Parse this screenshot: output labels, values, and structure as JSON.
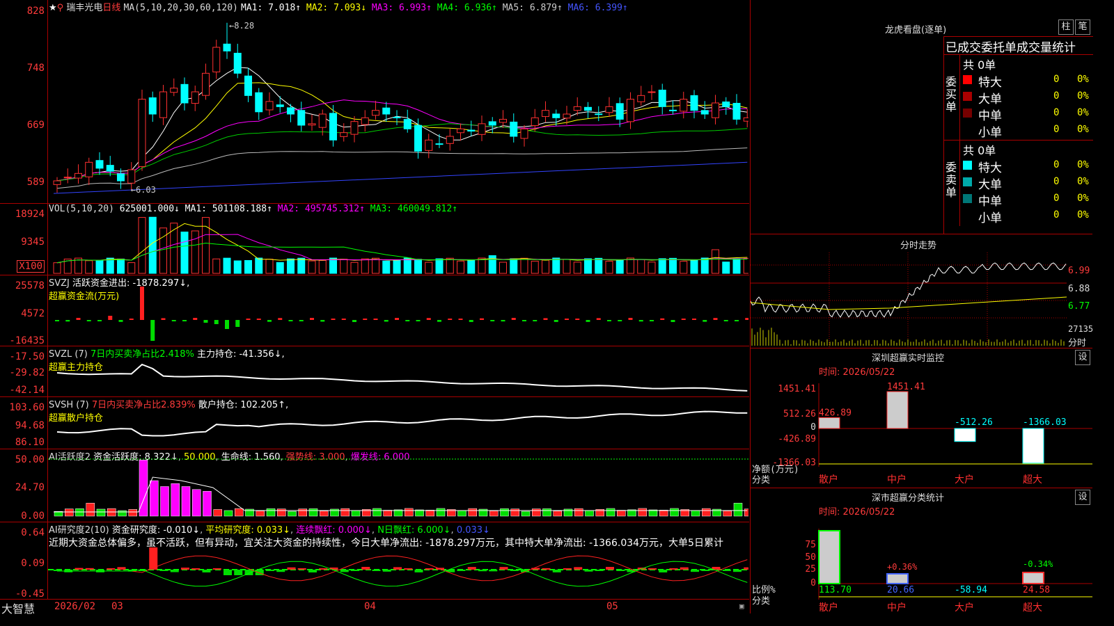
{
  "stock": {
    "name": "瑞丰光电",
    "period": "日线",
    "ma_label": "MA(5,10,20,30,60,120)",
    "ma": [
      {
        "t": "MA1: 7.018↑",
        "c": "#ffffff"
      },
      {
        "t": "MA2: 7.093↓",
        "c": "#ffff00"
      },
      {
        "t": "MA3: 6.993↑",
        "c": "#ff00ff"
      },
      {
        "t": "MA4: 6.936↑",
        "c": "#00ff00"
      },
      {
        "t": "MA5: 6.879↑",
        "c": "#cccccc"
      },
      {
        "t": "MA6: 6.399↑",
        "c": "#4455ff"
      }
    ],
    "hi_note": "8.28",
    "lo_note": "6.03",
    "y_ticks": [
      "828",
      "748",
      "669",
      "589"
    ]
  },
  "vol": {
    "label": "VOL(5,10,20)",
    "val": "625001.000↓",
    "ma1": "MA1: 501108.188↑",
    "ma2": "MA2: 495745.312↑",
    "ma3": "MA3: 460049.812↑",
    "y_ticks": [
      "18924",
      "9345"
    ],
    "unit": "X100"
  },
  "svzj": {
    "label": "SVZJ",
    "text": "活跃资金进出: -1878.297↓,",
    "sub": "超赢资金流(万元)",
    "y_ticks": [
      "25578",
      "4572",
      "-16435"
    ]
  },
  "svzl": {
    "label": "SVZL (7)",
    "text1": "7日内买卖净占比2.418%",
    "text2": "主力持仓: -41.356↓,",
    "sub": "超赢主力持仓",
    "y_ticks": [
      "-17.50",
      "-29.82",
      "-42.14"
    ]
  },
  "svsh": {
    "label": "SVSH (7)",
    "text1": "7日内买卖净占比2.839%",
    "text2": "散户持仓: 102.205↑,",
    "sub": "超赢散户持仓",
    "y_ticks": [
      "103.60",
      "94.68",
      "86.10"
    ]
  },
  "ai1": {
    "label": "AI活跃度2",
    "t1": "资金活跃度: 8.322↓",
    "t2": "50.000",
    "t3": "生命线: 1.560",
    "t4": "强势线: 3.000",
    "t5": "爆发线: 6.000",
    "y_ticks": [
      "50.00",
      "24.70",
      "0.00"
    ]
  },
  "ai2": {
    "label": "AI研究度2(10)",
    "t1": "资金研究度: -0.010↓",
    "t2": "平均研究度: 0.033↓",
    "t3": "连续飘红: 0.000↓",
    "t4": "N日飘红: 6.000↓",
    "t5": "0.033↓",
    "comment": "近期大资金总体偏多，虽不活跃，但有异动，宜关注大资金的持续性，今日大单净流出: -1878.297万元，其中特大单净流出: -1366.034万元，大单5日累计",
    "y_ticks": [
      "0.64",
      "0.09",
      "-0.45"
    ]
  },
  "xaxis": {
    "brand": "大智慧",
    "labels": [
      "2026/02",
      "03",
      "04",
      "05"
    ]
  },
  "dragon": {
    "title": "龙虎看盘(逐单)",
    "btn1": "柱",
    "btn2": "笔",
    "header": "已成交委托单成交量统计",
    "buy": {
      "label": "委买单",
      "total": "共 0单",
      "rows": [
        {
          "n": "特大",
          "v": "0",
          "p": "0%",
          "c": "#ff0000"
        },
        {
          "n": "大单",
          "v": "0",
          "p": "0%",
          "c": "#aa0000"
        },
        {
          "n": "中单",
          "v": "0",
          "p": "0%",
          "c": "#770000"
        },
        {
          "n": "小单",
          "v": "0",
          "p": "0%",
          "c": "#000000"
        }
      ]
    },
    "sell": {
      "label": "委卖单",
      "total": "共 0单",
      "rows": [
        {
          "n": "特大",
          "v": "0",
          "p": "0%",
          "c": "#00ffff"
        },
        {
          "n": "大单",
          "v": "0",
          "p": "0%",
          "c": "#00aaaa"
        },
        {
          "n": "中单",
          "v": "0",
          "p": "0%",
          "c": "#007777"
        },
        {
          "n": "小单",
          "v": "0",
          "p": "0%",
          "c": "#000000"
        }
      ]
    }
  },
  "intraday": {
    "title": "分时走势",
    "y_ticks": [
      "6.99",
      "6.88",
      "6.77"
    ],
    "vol_tick": "27135",
    "vol_unit": "分时"
  },
  "monitor": {
    "title": "深圳超赢实时监控",
    "btn": "设",
    "date": "时间: 2026/05/22",
    "y_ticks": [
      "1451.41",
      "512.26",
      "0",
      "-426.89",
      "-1366.03"
    ],
    "ylabel1": "净额(万元)",
    "ylabel2": "分类",
    "cats": [
      "散户",
      "中户",
      "大户",
      "超大"
    ],
    "values": [
      "426.89",
      "1451.41",
      "-512.26",
      "-1366.03"
    ]
  },
  "classify": {
    "title": "深市超赢分类统计",
    "btn": "设",
    "date": "时间: 2026/05/22",
    "y_ticks": [
      "75",
      "50",
      "25",
      "0"
    ],
    "ylabel1": "比例%",
    "ylabel2": "分类",
    "cats": [
      "散户",
      "中户",
      "大户",
      "超大"
    ],
    "values": [
      "113.70",
      "20.66",
      "-58.94",
      "24.58"
    ],
    "notes": [
      "+0.36%",
      "-0.34%"
    ]
  },
  "chart_data": [
    {
      "type": "candlestick",
      "title": "瑞丰光电 日线",
      "y_ticks": [
        828,
        748,
        669,
        589
      ],
      "close": [
        6.15,
        6.2,
        6.25,
        6.4,
        6.32,
        6.28,
        6.15,
        6.3,
        7.25,
        7.05,
        7.35,
        7.4,
        7.2,
        7.35,
        7.6,
        7.95,
        7.9,
        7.6,
        7.3,
        7.08,
        7.22,
        7.15,
        7.05,
        6.9,
        6.92,
        7.05,
        6.7,
        6.8,
        6.95,
        7.0,
        7.1,
        7.05,
        7.0,
        6.85,
        6.55,
        6.7,
        6.65,
        6.75,
        6.85,
        6.82,
        6.92,
        6.9,
        6.98,
        6.75,
        6.85,
        7.0,
        7.1,
        7.0,
        7.05,
        7.15,
        7.1,
        7.05,
        7.15,
        6.98,
        7.25,
        7.3,
        7.35,
        7.15,
        7.1,
        7.25,
        7.1,
        7.05,
        7.2,
        7.15,
        6.98,
        7.0
      ],
      "ma6_start": 5.98,
      "ma6_end": 6.4
    },
    {
      "type": "bar",
      "title": "VOL(5,10,20)",
      "y_ticks": [
        18924,
        9345
      ]
    },
    {
      "type": "bar",
      "title": "超赢资金流(万元)",
      "y_ticks": [
        25578,
        4572,
        -16435
      ]
    },
    {
      "type": "line",
      "title": "超赢主力持仓",
      "y_ticks": [
        -17.5,
        -29.82,
        -42.14
      ]
    },
    {
      "type": "line",
      "title": "超赢散户持仓",
      "y_ticks": [
        103.6,
        94.68,
        86.1
      ]
    },
    {
      "type": "bar",
      "title": "AI活跃度2",
      "y_ticks": [
        50,
        24.7,
        0
      ]
    },
    {
      "type": "bar",
      "title": "AI研究度2(10)",
      "y_ticks": [
        0.64,
        0.09,
        -0.45
      ]
    },
    {
      "type": "bar",
      "title": "深圳超赢实时监控",
      "categories": [
        "散户",
        "中户",
        "大户",
        "超大"
      ],
      "values": [
        426.89,
        1451.41,
        -512.26,
        -1366.03
      ]
    },
    {
      "type": "bar",
      "title": "深市超赢分类统计",
      "categories": [
        "散户",
        "中户",
        "大户",
        "超大"
      ],
      "values": [
        113.7,
        20.66,
        -58.94,
        24.58
      ]
    }
  ]
}
